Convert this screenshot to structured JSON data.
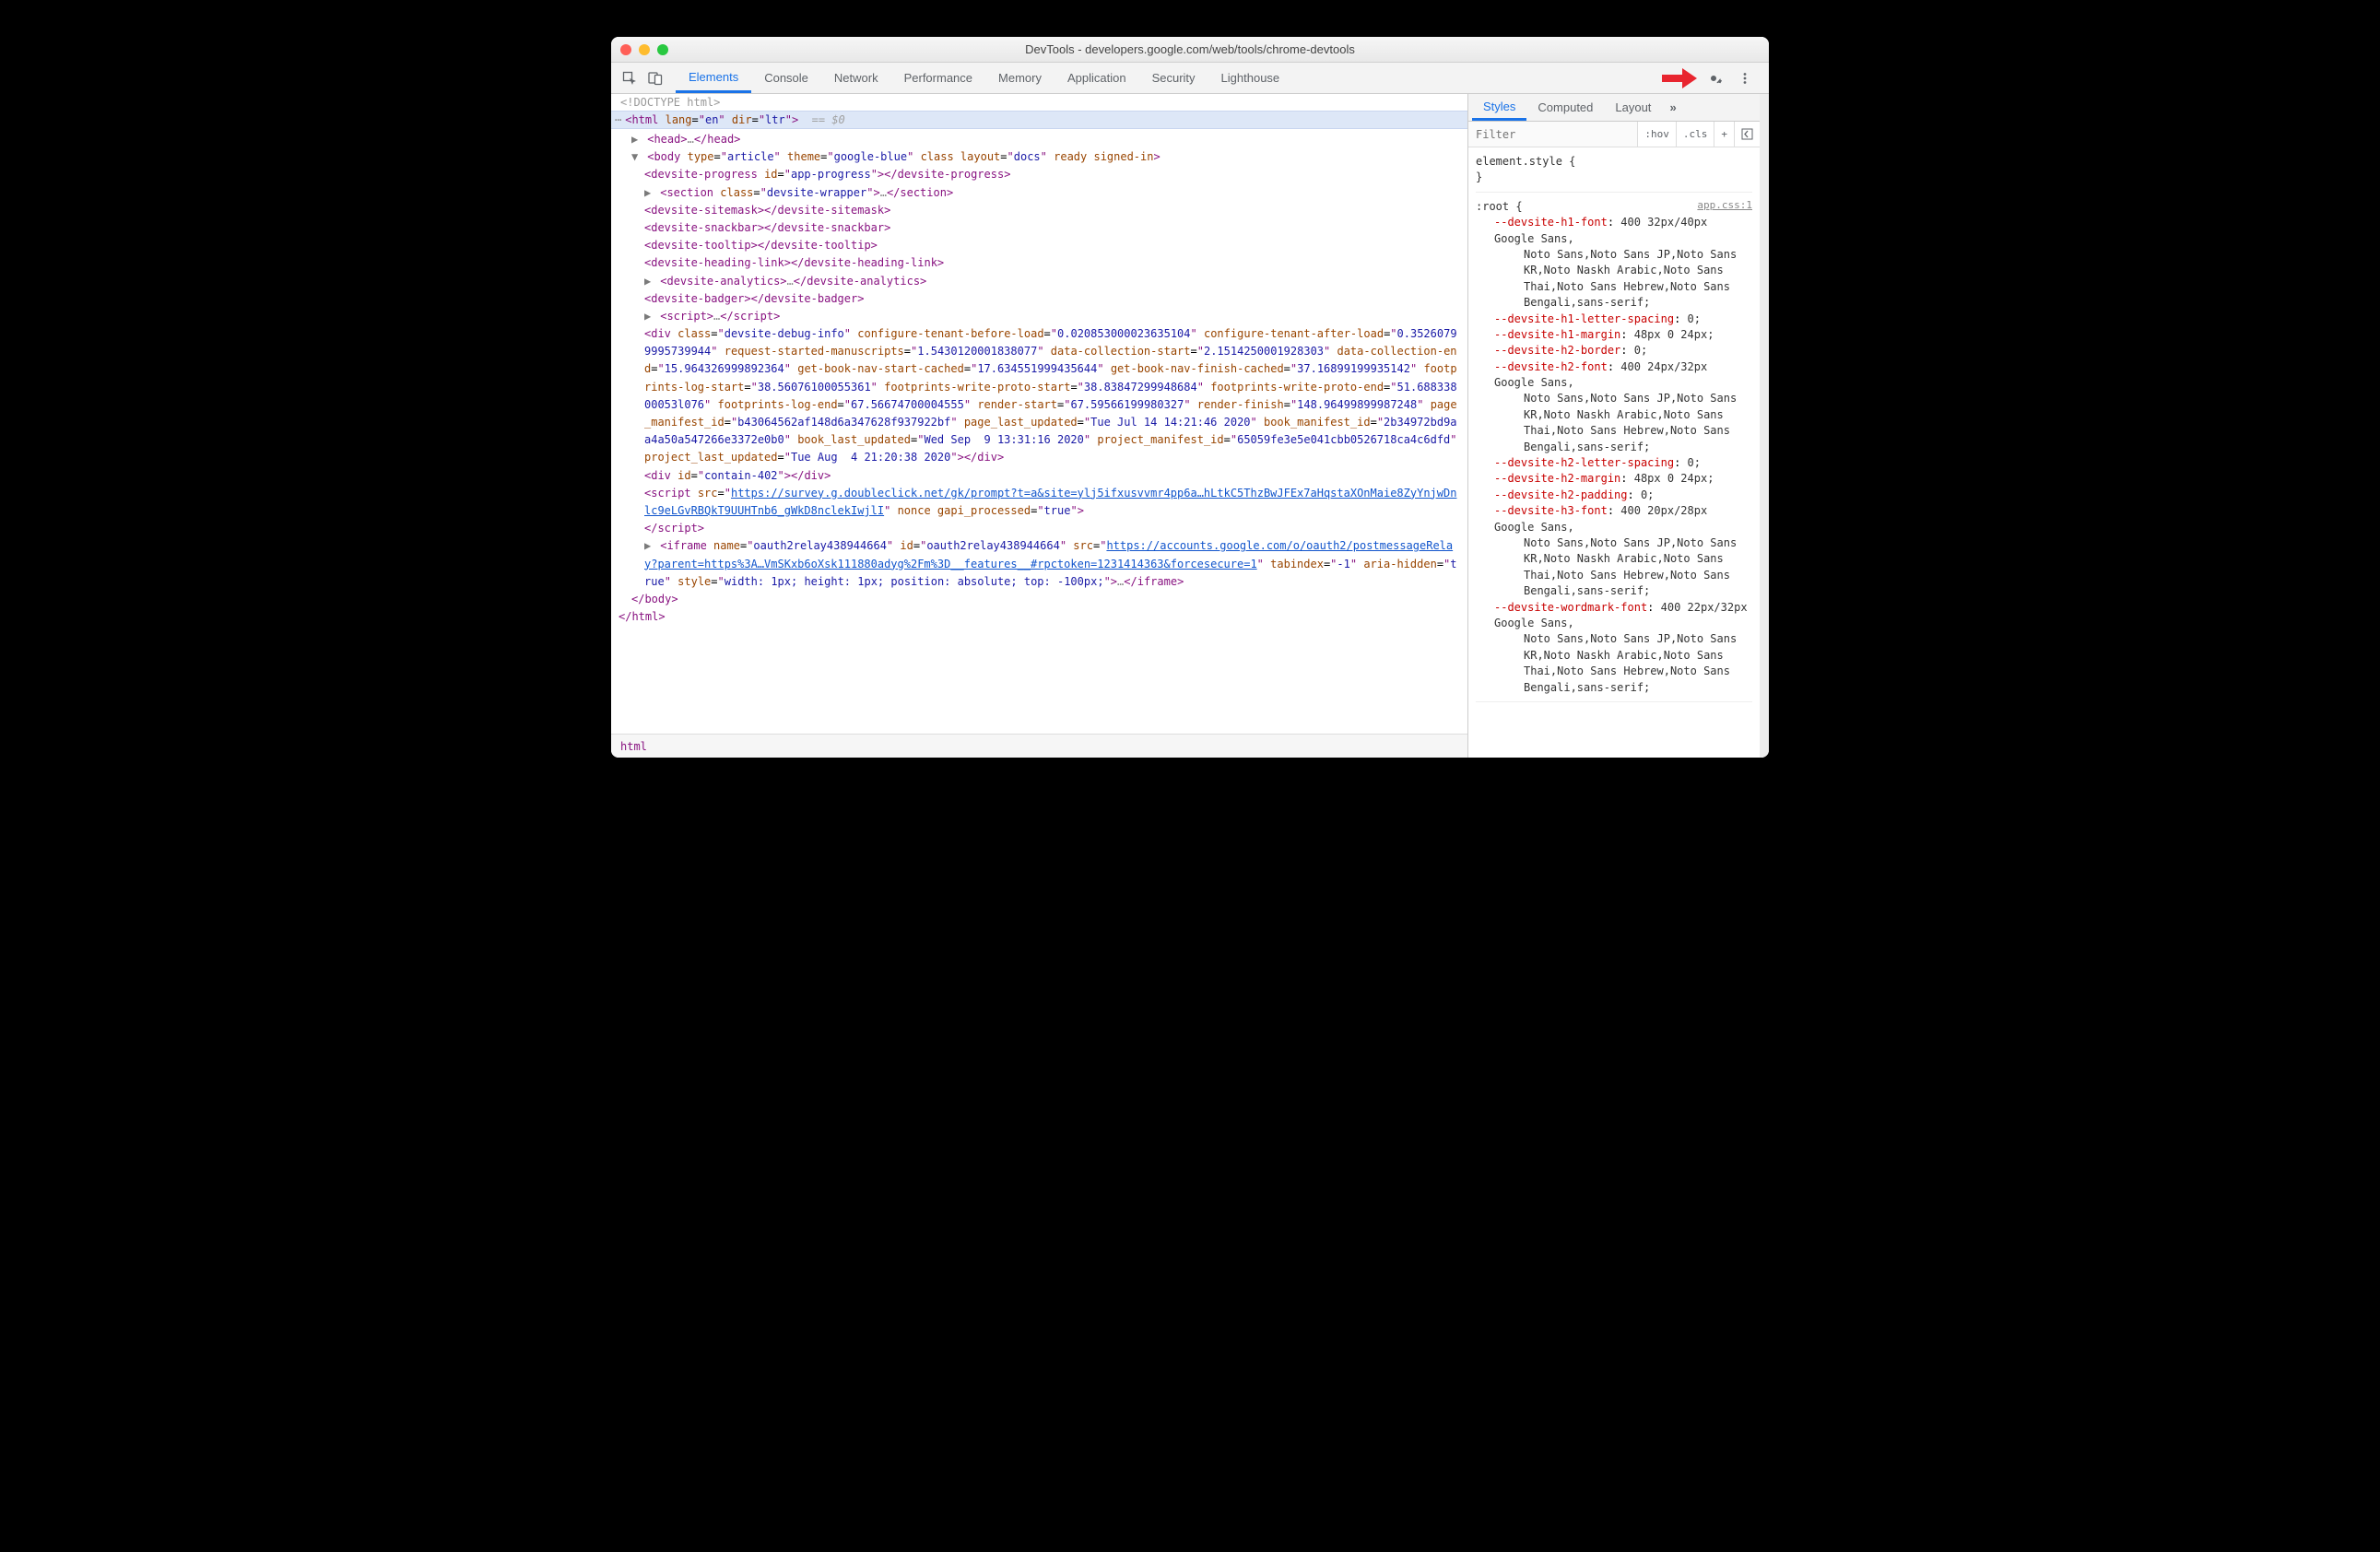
{
  "window": {
    "title": "DevTools - developers.google.com/web/tools/chrome-devtools"
  },
  "tabs": [
    "Elements",
    "Console",
    "Network",
    "Performance",
    "Memory",
    "Application",
    "Security",
    "Lighthouse"
  ],
  "active_tab": "Elements",
  "style_tabs": [
    "Styles",
    "Computed",
    "Layout"
  ],
  "active_style_tab": "Styles",
  "filter_placeholder": "Filter",
  "chips": {
    "hov": ":hov",
    "cls": ".cls"
  },
  "elstyle": {
    "selector": "element.style {",
    "close": "}"
  },
  "root_rule": {
    "selector": ":root {",
    "source": "app.css:1",
    "props": [
      {
        "n": "--devsite-h1-font",
        "v": "400 32px/40px Google Sans,Noto Sans,Noto Sans JP,Noto Sans KR,Noto Naskh Arabic,Noto Sans Thai,Noto Sans Hebrew,Noto Sans Bengali,sans-serif;"
      },
      {
        "n": "--devsite-h1-letter-spacing",
        "v": "0;"
      },
      {
        "n": "--devsite-h1-margin",
        "v": "48px 0 24px;"
      },
      {
        "n": "--devsite-h2-border",
        "v": "0;"
      },
      {
        "n": "--devsite-h2-font",
        "v": "400 24px/32px Google Sans,Noto Sans,Noto Sans JP,Noto Sans KR,Noto Naskh Arabic,Noto Sans Thai,Noto Sans Hebrew,Noto Sans Bengali,sans-serif;"
      },
      {
        "n": "--devsite-h2-letter-spacing",
        "v": "0;"
      },
      {
        "n": "--devsite-h2-margin",
        "v": "48px 0 24px;"
      },
      {
        "n": "--devsite-h2-padding",
        "v": "0;"
      },
      {
        "n": "--devsite-h3-font",
        "v": "400 20px/28px Google Sans,Noto Sans,Noto Sans JP,Noto Sans KR,Noto Naskh Arabic,Noto Sans Thai,Noto Sans Hebrew,Noto Sans Bengali,sans-serif;"
      },
      {
        "n": "--devsite-wordmark-font",
        "v": "400 22px/32px Google Sans,Noto Sans,Noto Sans JP,Noto Sans KR,Noto Naskh Arabic,Noto Sans Thai,Noto Sans Hebrew,Noto Sans Bengali,sans-serif;"
      }
    ]
  },
  "crumbs": "html",
  "dom": {
    "doctype": "<!DOCTYPE html>",
    "html_open": {
      "lang": "en",
      "dir": "ltr",
      "suffix": " == $0"
    },
    "head": "▶ <head>…</head>",
    "body_attrs": {
      "type": "article",
      "theme": "google-blue",
      "layout": "docs",
      "tail": " ready signed-in"
    },
    "progress_id": "app-progress",
    "section_class": "devsite-wrapper",
    "plain_tags": [
      "devsite-sitemask",
      "devsite-snackbar",
      "devsite-tooltip",
      "devsite-heading-link"
    ],
    "analytics": "devsite-analytics",
    "badger": "devsite-badger",
    "debug": {
      "class": "devsite-debug-info",
      "attrs": [
        [
          "configure-tenant-before-load",
          "0.020853000023635104"
        ],
        [
          "configure-tenant-after-load",
          "0.35260799995739944"
        ],
        [
          "request-started-manuscripts",
          "1.5430120001838077"
        ],
        [
          "data-collection-start",
          "2.1514250001928303"
        ],
        [
          "data-collection-end",
          "15.964326999892364"
        ],
        [
          "get-book-nav-start-cached",
          "17.634551999435644"
        ],
        [
          "get-book-nav-finish-cached",
          "37.16899199935142"
        ],
        [
          "footprints-log-start",
          "38.56076100055361"
        ],
        [
          "footprints-write-proto-start",
          "38.83847299948684"
        ],
        [
          "footprints-write-proto-end",
          "51.68833800053l076"
        ],
        [
          "footprints-log-end",
          "67.56674700004555"
        ],
        [
          "render-start",
          "67.59566199980327"
        ],
        [
          "render-finish",
          "148.96499899987248"
        ],
        [
          "page_manifest_id",
          "b43064562af148d6a347628f937922bf"
        ],
        [
          "page_last_updated",
          "Tue Jul 14 14:21:46 2020"
        ],
        [
          "book_manifest_id",
          "2b34972bd9aa4a50a547266e3372e0b0"
        ],
        [
          "book_last_updated",
          "Wed Sep  9 13:31:16 2020"
        ],
        [
          "project_manifest_id",
          "65059fe3e5e041cbb0526718ca4c6dfd"
        ],
        [
          "project_last_updated",
          "Tue Aug  4 21:20:38 2020"
        ]
      ]
    },
    "contain_id": "contain-402",
    "survey_src": "https://survey.g.doubleclick.net/gk/prompt?t=a&site=ylj5ifxusvvmr4pp6a…hLtkC5ThzBwJFEx7aHqstaXOnMaie8ZyYnjwDnlc9eLGvRBQkT9UUHTnb6_gWkD8nclekIwjlI",
    "gapi": "true",
    "iframe": {
      "name": "oauth2relay438944664",
      "id": "oauth2relay438944664",
      "src": "https://accounts.google.com/o/oauth2/postmessageRelay?parent=https%3A…VmSKxb6oXsk111880adyg%2Fm%3D__features__#rpctoken=1231414363&forcesecure=1",
      "tabindex": "-1",
      "aria": "true",
      "style": "width: 1px; height: 1px; position: absolute; top: -100px;"
    }
  }
}
